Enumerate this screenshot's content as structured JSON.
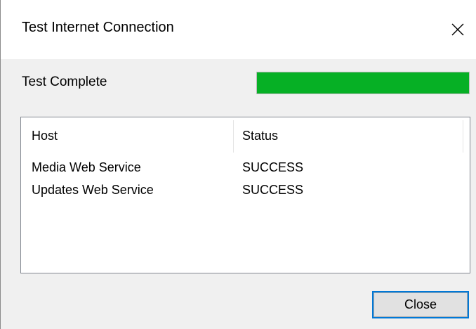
{
  "window": {
    "title": "Test Internet Connection",
    "close_icon": "close-icon"
  },
  "status": {
    "label": "Test Complete",
    "progress_percent": 100,
    "progress_color": "#06b025"
  },
  "list": {
    "columns": [
      "Host",
      "Status"
    ],
    "rows": [
      {
        "host": "Media Web Service",
        "status": "SUCCESS"
      },
      {
        "host": "Updates Web Service",
        "status": "SUCCESS"
      }
    ]
  },
  "buttons": {
    "close_label": "Close"
  },
  "colors": {
    "accent": "#0078d7"
  }
}
